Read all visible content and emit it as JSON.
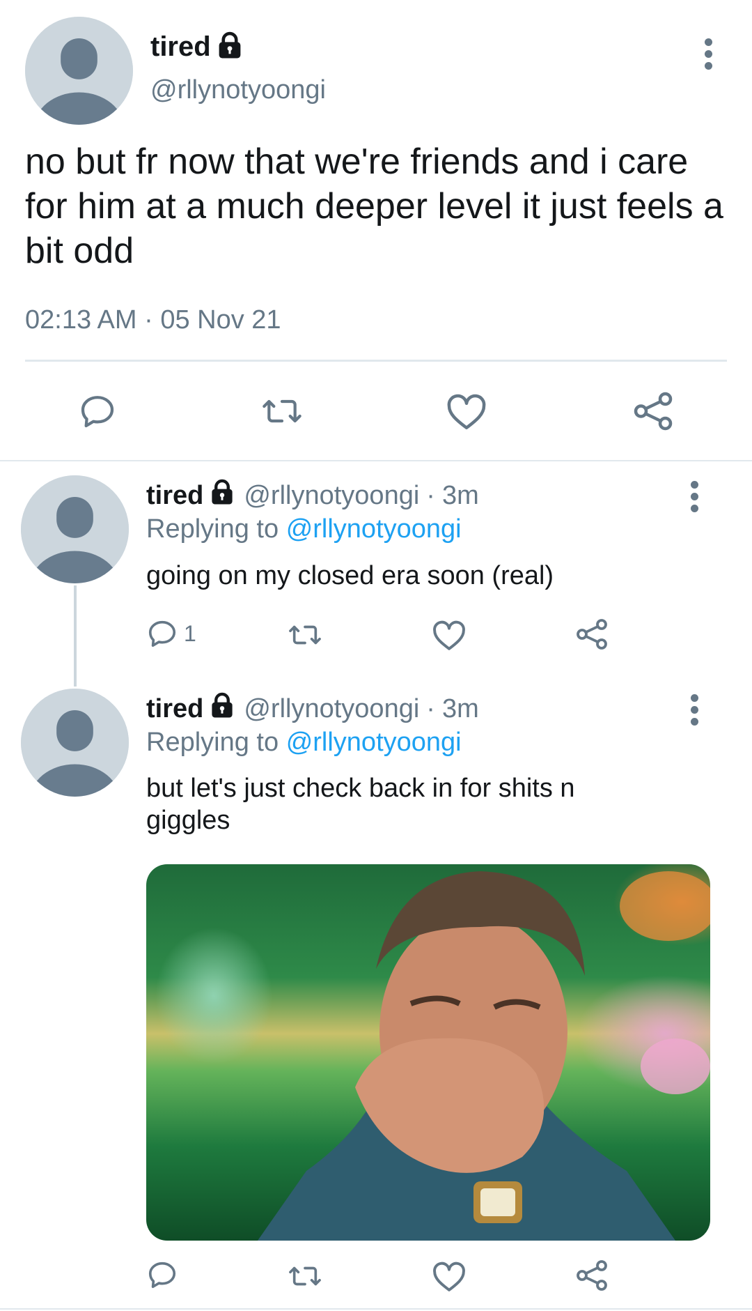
{
  "main_tweet": {
    "display_name": "tired",
    "handle": "@rllynotyoongi",
    "text": "no but fr now that we're friends and i care for him at a much deeper level it just feels a bit odd",
    "timestamp": "02:13 AM · 05 Nov 21",
    "icons": [
      "lock-icon",
      "more-vertical-icon",
      "reply-icon",
      "retweet-icon",
      "like-icon",
      "share-icon"
    ]
  },
  "replies": [
    {
      "display_name": "tired",
      "handle": "@rllynotyoongi",
      "separator": "·",
      "age": "3m",
      "replying_prefix": "Replying to",
      "replying_to": "@rllynotyoongi",
      "text": "going on my closed era soon (real)",
      "reply_count": "1"
    },
    {
      "display_name": "tired",
      "handle": "@rllynotyoongi",
      "separator": "·",
      "age": "3m",
      "replying_prefix": "Replying to",
      "replying_to": "@rllynotyoongi",
      "text": "but let's just check back in for shits n giggles",
      "reply_count": "",
      "media": "gif-image"
    }
  ],
  "colors": {
    "text": "#14171a",
    "muted": "#657786",
    "link": "#1da1f2",
    "divider": "#e1e8ed",
    "avatar_bg": "#ccd6dd",
    "avatar_fg": "#687c8e"
  }
}
